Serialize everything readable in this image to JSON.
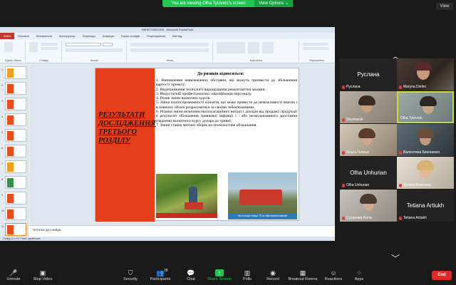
{
  "banner": {
    "text": "You are viewing Olha Tytovets's screen",
    "options": "View Options ⌄"
  },
  "view_button": "View",
  "powerpoint": {
    "window_title": "НВНЕТ23521505 - Microsoft PowerPoint",
    "tabs": [
      "Файл",
      "Основне",
      "Вставлення",
      "Конструктор",
      "Переходи",
      "Анімація",
      "Показ слайдів",
      "Рецензування",
      "Вигляд"
    ],
    "ribbon_groups": [
      "Буфер обміну",
      "Слайди",
      "Шрифт",
      "Абзац",
      "Креслення",
      "Редагування"
    ],
    "thumb_numbers": [
      "1",
      "2",
      "3",
      "4",
      "5",
      "6",
      "7",
      "8",
      "9",
      "10",
      "11"
    ],
    "slide": {
      "title_lines": [
        "РЕЗУЛЬТАТИ",
        "ДОСЛІДЖЕННЯ",
        "ТРЕТЬОГО",
        "РОЗДІЛУ"
      ],
      "heading": "До ризиків відносяться:",
      "items": [
        "1. Виникнення невизначених обставин, які можуть призвести до збільшення вартості проекту;",
        "2. Недотримання технології вирощування ремонтантної малини.",
        "3. Недостатній професіоналізм і кваліфікація персоналу.",
        "4. Ризик зміни валютних курсів.",
        "5. Зміна платоспроможності клієнтів, що може привести до неможливості вчасно і в повному обсязі розрахуватися за своїми зобов'язаннями.",
        "6. Ризики зміни величини експлуатаційних витрат і доходів від продажу продукції в результаті збільшення гривневої інфляції і / або незапланованого зростання (падіння) валютного курсу долара до гривні;",
        "7. Зміни ставок митних зборів на технологічне обладнання."
      ],
      "photo2_caption": "На площах більш 70 га збір механізований"
    },
    "notes": "Нотатки до слайда",
    "status": "Слайд 11 з 15   \"Тема\"   українська"
  },
  "participants": [
    {
      "display": "Руслана",
      "label": "Руслана",
      "muted": true,
      "video": false
    },
    {
      "display": "",
      "label": "Maryna Dielini",
      "muted": true,
      "video": true
    },
    {
      "display": "",
      "label": "Shynkaruk",
      "muted": true,
      "video": true
    },
    {
      "display": "",
      "label": "Olha Tytovets",
      "muted": false,
      "video": true,
      "active": true
    },
    {
      "display": "",
      "label": "Ольга Галица",
      "muted": true,
      "video": true
    },
    {
      "display": "",
      "label": "Валентина Бихоненко",
      "muted": true,
      "video": true
    },
    {
      "display": "Olha Unhurian",
      "label": "Olha Unhurian",
      "muted": true,
      "video": false
    },
    {
      "display": "",
      "label": "Тетяна Власенко",
      "muted": true,
      "video": true
    },
    {
      "display": "",
      "label": "Суханова Алла",
      "muted": true,
      "video": true
    },
    {
      "display": "Tetiana Artiukh",
      "label": "Tetiana Artiukh",
      "muted": true,
      "video": false
    }
  ],
  "toolbar": {
    "unmute": "Unmute",
    "stop_video": "Stop Video",
    "security": "Security",
    "participants": "Participants",
    "participants_count": "28",
    "chat": "Chat",
    "share_screen": "Share Screen",
    "polls": "Polls",
    "record": "Record",
    "breakout": "Breakout Rooms",
    "reactions": "Reactions",
    "apps": "Apps",
    "end": "End"
  }
}
